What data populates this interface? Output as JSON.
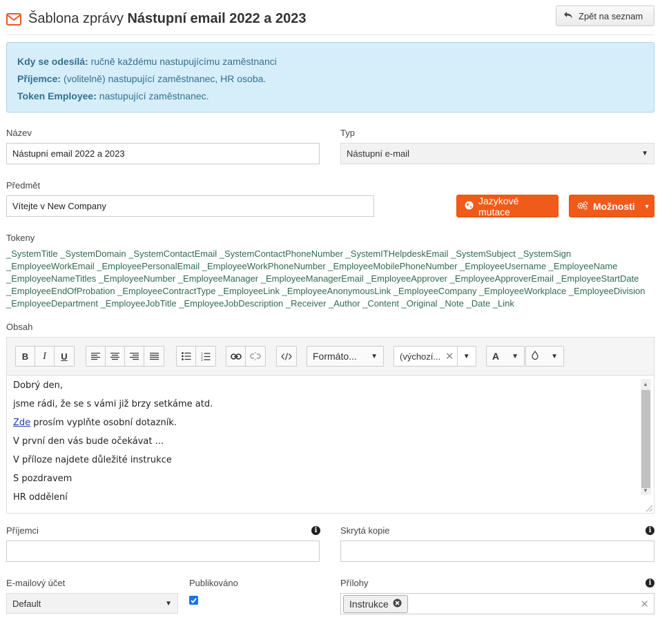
{
  "header": {
    "title_prefix": "Šablona zprávy",
    "title_name": "Nástupní email 2022 a 2023",
    "back_button": "Zpět na seznam"
  },
  "info": {
    "send_label": "Kdy se odesílá:",
    "send_value": "ručně každému nastupujícímu zaměstnanci",
    "recipient_label": "Příjemce:",
    "recipient_value": "(volitelně) nastupující zaměstnanec, HR osoba.",
    "token_label": "Token Employee:",
    "token_value": "nastupující zaměstnanec."
  },
  "form": {
    "name_label": "Název",
    "name_value": "Nástupní email 2022 a 2023",
    "type_label": "Typ",
    "type_value": "Nástupní e-mail",
    "subject_label": "Předmět",
    "subject_value": "Vítejte v New Company",
    "lang_button": "Jazykové mutace",
    "options_button": "Možnosti",
    "tokens_label": "Tokeny",
    "tokens_text": "_SystemTitle _SystemDomain _SystemContactEmail _SystemContactPhoneNumber _SystemITHelpdeskEmail _SystemSubject _SystemSign _EmployeeWorkEmail _EmployeePersonalEmail _EmployeeWorkPhoneNumber _EmployeeMobilePhoneNumber _EmployeeUsername _EmployeeName _EmployeeNameTitles _EmployeeNumber _EmployeeManager _EmployeeManagerEmail _EmployeeApprover _EmployeeApproverEmail _EmployeeStartDate _EmployeeEndOfProbation _EmployeeContractType _EmployeeLink _EmployeeAnonymousLink _EmployeeCompany _EmployeeWorkplace _EmployeeDivision _EmployeeDepartment _EmployeeJobTitle _EmployeeJobDescription _Receiver _Author _Content _Original _Note _Date _Link",
    "content_label": "Obsah",
    "recipients_label": "Příjemci",
    "recipients_value": "",
    "bcc_label": "Skrytá kopie",
    "bcc_value": "",
    "account_label": "E-mailový účet",
    "account_value": "Default",
    "published_label": "Publikováno",
    "attachments_label": "Přílohy",
    "attachment_tag": "Instrukce"
  },
  "editor": {
    "bold": "B",
    "italic": "I",
    "underline": "U",
    "format_dropdown": "Formáto...",
    "font_dropdown": "(výchozí...",
    "font_color": "A",
    "lines": {
      "l1": "Dobrý den,",
      "l2": "jsme rádi, že se s vámi již brzy setkáme atd.",
      "l3_link": "Zde",
      "l3_rest": " prosím vyplňte osobní dotazník.",
      "l4": "V první den vás bude očekávat ...",
      "l5": "V příloze najdete důležité instrukce",
      "l6": "S pozdravem",
      "l7": "HR oddělení"
    }
  },
  "colors": {
    "accent": "#f05a1a",
    "info_bg": "#d6eefa",
    "info_text": "#31708f",
    "token_text": "#2f6b4f"
  }
}
